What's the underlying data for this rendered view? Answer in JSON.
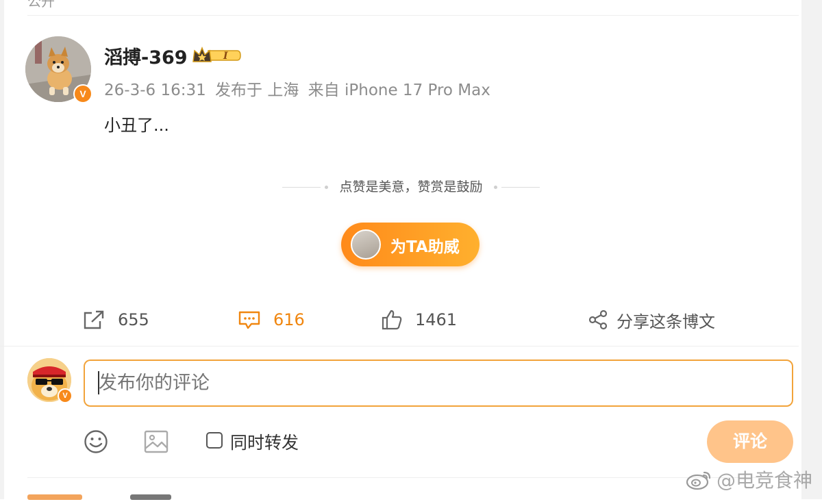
{
  "colors": {
    "accent": "#f0860f",
    "button_gradient_start": "#ff8a1a",
    "button_gradient_end": "#ffb02e",
    "verified": "#f7891a",
    "submit_disabled": "#ffc48a"
  },
  "top_partial_text": "公开",
  "post": {
    "username": "滔搏-369",
    "badge_level": "I",
    "timestamp": "26-3-6 16:31",
    "location": "发布于 上海",
    "source": "来自 iPhone 17 Pro Max",
    "content": "小丑了...",
    "reward_hint": "点赞是美意，赞赏是鼓励",
    "support_button_label": "为TA助威"
  },
  "actions": {
    "repost_count": "655",
    "comment_count": "616",
    "like_count": "1461",
    "share_label": "分享这条博文"
  },
  "composer": {
    "placeholder": "发布你的评论",
    "sync_repost_label": "同时转发",
    "submit_label": "评论"
  },
  "watermark": "@电竞食神",
  "icons": [
    "verified-badge-icon",
    "crown-badge-icon",
    "repost-icon",
    "comment-icon",
    "like-icon",
    "share-icon",
    "emoji-icon",
    "image-icon",
    "weibo-logo-icon"
  ]
}
